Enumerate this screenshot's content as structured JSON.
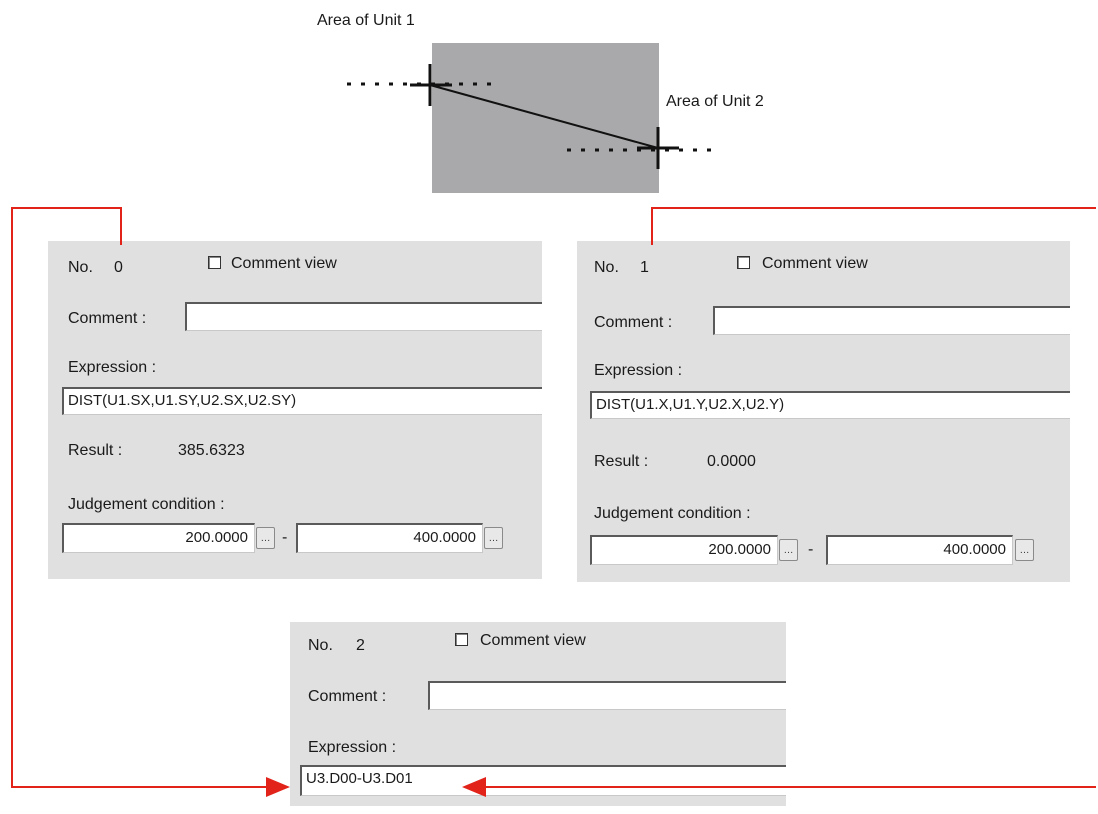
{
  "diagram": {
    "unit1_label": "Area of Unit 1",
    "unit2_label": "Area of Unit 2",
    "arrow_color": "#e2231a"
  },
  "panels": [
    {
      "no_label": "No.",
      "no_value": "0",
      "comment_view_label": "Comment view",
      "comment_label": "Comment :",
      "comment_value": "",
      "expression_label": "Expression :",
      "expression_value": "DIST(U1.SX,U1.SY,U2.SX,U2.SY)",
      "result_label": "Result :",
      "result_value": "385.6323",
      "judgement_label": "Judgement condition :",
      "judgement_min": "200.0000",
      "judgement_sep": "-",
      "judgement_max": "400.0000"
    },
    {
      "no_label": "No.",
      "no_value": "1",
      "comment_view_label": "Comment view",
      "comment_label": "Comment :",
      "comment_value": "",
      "expression_label": "Expression :",
      "expression_value": "DIST(U1.X,U1.Y,U2.X,U2.Y)",
      "result_label": "Result :",
      "result_value": "0.0000",
      "judgement_label": "Judgement condition :",
      "judgement_min": "200.0000",
      "judgement_sep": "-",
      "judgement_max": "400.0000"
    },
    {
      "no_label": "No.",
      "no_value": "2",
      "comment_view_label": "Comment view",
      "comment_label": "Comment :",
      "comment_value": "",
      "expression_label": "Expression :",
      "expression_value": "U3.D00-U3.D01"
    }
  ]
}
